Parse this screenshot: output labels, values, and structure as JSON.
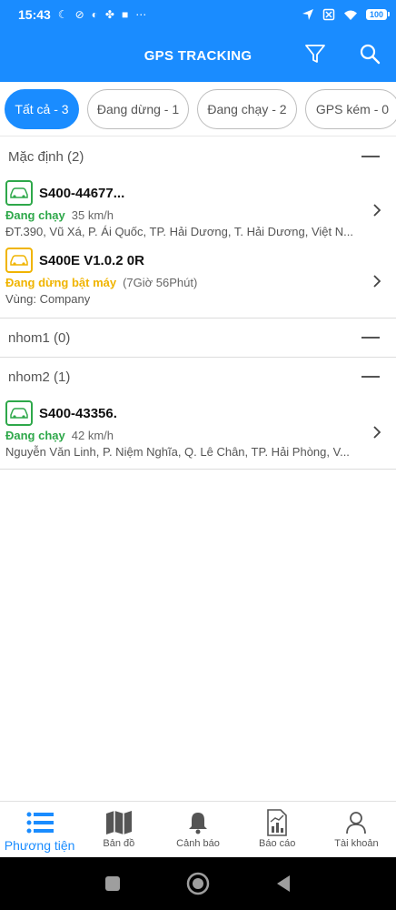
{
  "status_bar": {
    "time": "15:43",
    "battery": "100"
  },
  "app_bar": {
    "title": "GPS TRACKING"
  },
  "filters": [
    {
      "label": "Tất cả - 3",
      "active": true
    },
    {
      "label": "Đang dừng - 1",
      "active": false
    },
    {
      "label": "Đang chạy - 2",
      "active": false
    },
    {
      "label": "GPS kém - 0",
      "active": false
    }
  ],
  "groups": [
    {
      "title": "Mặc định (2)",
      "vehicles": [
        {
          "plate": "S400-44677...",
          "status": "Đang chạy",
          "status_type": "running",
          "detail": "35 km/h",
          "address": "ĐT.390, Vũ Xá, P. Ái Quốc, TP. Hải Dương, T. Hải Dương, Việt N..."
        },
        {
          "plate": "S400E V1.0.2 0R",
          "status": "Đang dừng bật máy",
          "status_type": "idle",
          "detail": "(7Giờ 56Phút)",
          "address": "Vùng: Company"
        }
      ]
    },
    {
      "title": "nhom1 (0)",
      "vehicles": []
    },
    {
      "title": "nhom2 (1)",
      "vehicles": [
        {
          "plate": "S400-43356.",
          "status": "Đang chạy",
          "status_type": "running",
          "detail": "42 km/h",
          "address": "Nguyễn Văn Linh, P. Niệm Nghĩa, Q. Lê Chân, TP. Hải Phòng, V..."
        }
      ]
    }
  ],
  "bottom_nav": [
    {
      "label": "Phương tiện",
      "icon": "list-icon",
      "active": true
    },
    {
      "label": "Bản đồ",
      "icon": "map-icon",
      "active": false
    },
    {
      "label": "Cảnh báo",
      "icon": "bell-icon",
      "active": false
    },
    {
      "label": "Báo cáo",
      "icon": "report-icon",
      "active": false
    },
    {
      "label": "Tài khoản",
      "icon": "user-icon",
      "active": false
    }
  ],
  "colors": {
    "primary": "#1a8cff",
    "running": "#2ea84a",
    "idle": "#f0b400"
  }
}
